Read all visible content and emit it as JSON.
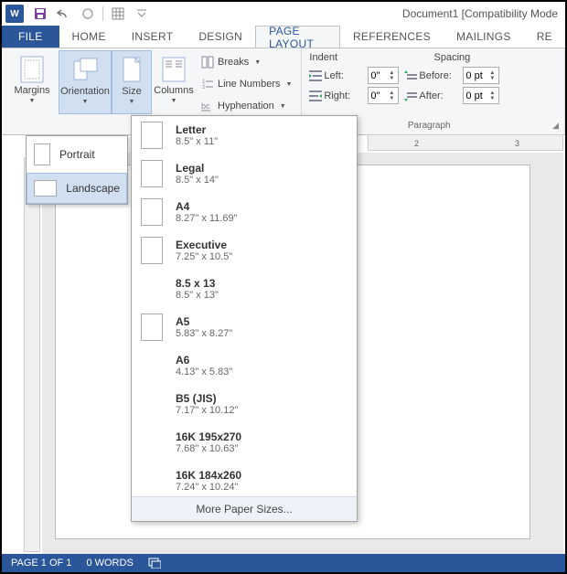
{
  "titlebar": {
    "document_title": "Document1 [Compatibility Mode"
  },
  "tabs": {
    "file": "FILE",
    "home": "HOME",
    "insert": "INSERT",
    "design": "DESIGN",
    "page_layout": "PAGE LAYOUT",
    "references": "REFERENCES",
    "mailings": "MAILINGS",
    "review_partial": "RE"
  },
  "ribbon": {
    "page_setup": {
      "margins": "Margins",
      "orientation": "Orientation",
      "size": "Size",
      "columns": "Columns",
      "breaks": "Breaks",
      "line_numbers": "Line Numbers",
      "hyphenation": "Hyphenation"
    },
    "indent": {
      "title": "Indent",
      "left_label": "Left:",
      "left_value": "0\"",
      "right_label": "Right:",
      "right_value": "0\""
    },
    "spacing": {
      "title": "Spacing",
      "before_label": "Before:",
      "before_value": "0 pt",
      "after_label": "After:",
      "after_value": "0 pt"
    },
    "paragraph_label": "Paragraph"
  },
  "orientation_menu": {
    "portrait": "Portrait",
    "landscape": "Landscape"
  },
  "size_menu": {
    "items": [
      {
        "name": "Letter",
        "dims": "8.5\" x 11\"",
        "thumb": true
      },
      {
        "name": "Legal",
        "dims": "8.5\" x 14\"",
        "thumb": true
      },
      {
        "name": "A4",
        "dims": "8.27\" x 11.69\"",
        "thumb": true
      },
      {
        "name": "Executive",
        "dims": "7.25\" x 10.5\"",
        "thumb": true
      },
      {
        "name": "8.5 x 13",
        "dims": "8.5\" x 13\"",
        "thumb": false
      },
      {
        "name": "A5",
        "dims": "5.83\" x 8.27\"",
        "thumb": true
      },
      {
        "name": "A6",
        "dims": "4.13\" x 5.83\"",
        "thumb": false
      },
      {
        "name": "B5 (JIS)",
        "dims": "7.17\" x 10.12\"",
        "thumb": false
      },
      {
        "name": "16K 195x270",
        "dims": "7.68\" x 10.63\"",
        "thumb": false
      },
      {
        "name": "16K 184x260",
        "dims": "7.24\" x 10.24\"",
        "thumb": false
      }
    ],
    "more": "More Paper Sizes..."
  },
  "ruler": {
    "mark2": "2",
    "mark3": "3"
  },
  "statusbar": {
    "page": "PAGE 1 OF 1",
    "words": "0 WORDS"
  }
}
